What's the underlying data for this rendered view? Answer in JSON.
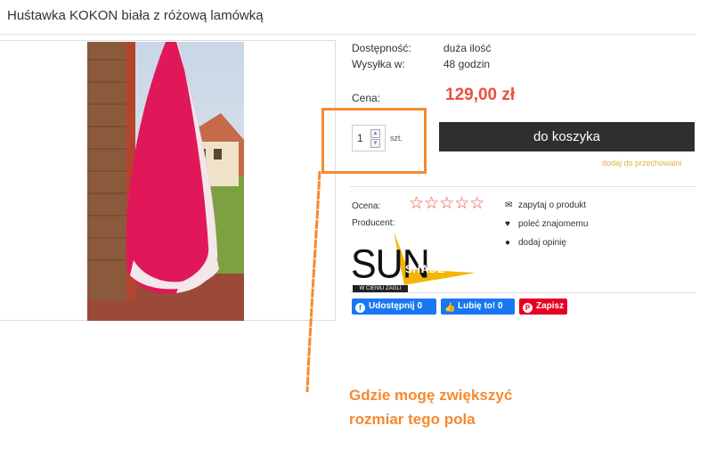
{
  "product": {
    "title": "Huśtawka KOKON biała z różową lamówką",
    "availability_label": "Dostępność:",
    "availability_value": "duża ilość",
    "shipping_label": "Wysyłka w:",
    "shipping_value": "48 godzin",
    "price_label": "Cena:",
    "price_value": "129,00 zł"
  },
  "purchase": {
    "quantity": "1",
    "unit": "szt.",
    "add_to_cart": "do koszyka",
    "add_to_storage": "dodaj do przechowalni"
  },
  "details": {
    "rating_label": "Ocena:",
    "rating_stars": 0,
    "producer_label": "Producent:",
    "logo_text": "SUN",
    "logo_shade": "SHADE",
    "logo_subtext": "W CIENIU ŻAGLI"
  },
  "side_actions": [
    {
      "icon": "envelope-icon",
      "label": "zapytaj o produkt"
    },
    {
      "icon": "heart-icon",
      "label": "poleć znajomemu"
    },
    {
      "icon": "comment-icon",
      "label": "dodaj opinię"
    }
  ],
  "social": {
    "fb_share": "Udostępnij 0",
    "fb_like": "Lubię to! 0",
    "pinterest": "Zapisz"
  },
  "annotation": {
    "line1": "Gdzie mogę zwiększyć",
    "line2": "rozmiar tego pola"
  },
  "colors": {
    "price": "#e8513d",
    "cart_button": "#2f2f2f",
    "annotation": "#f58a2e",
    "facebook": "#1877f2",
    "pinterest": "#e60023",
    "store_link": "#e0b23a"
  }
}
